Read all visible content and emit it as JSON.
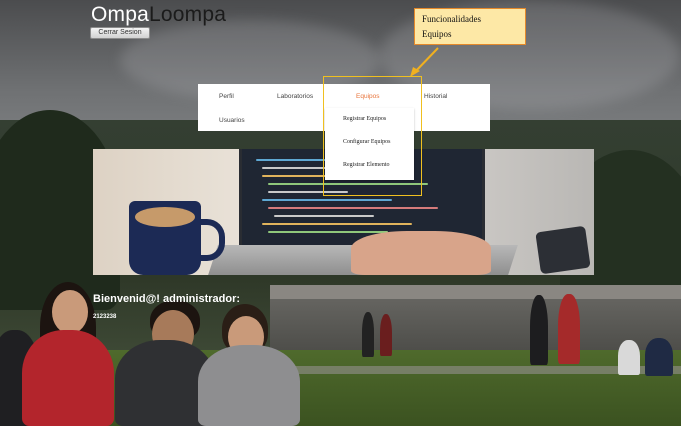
{
  "brand": {
    "part1": "Ompa",
    "part2": "Loompa"
  },
  "header": {
    "logout_label": "Cerrar Sesion"
  },
  "callout": {
    "line1": "Funcionalidades",
    "line2": "Equipos"
  },
  "nav": {
    "items": [
      {
        "label": "Perfil",
        "active": false
      },
      {
        "label": "Laboratorios",
        "active": false
      },
      {
        "label": "Equipos",
        "active": true
      },
      {
        "label": "Historial",
        "active": false
      },
      {
        "label": "Usuarios",
        "active": false
      }
    ],
    "dropdown": [
      "Registrar Equipos",
      "Configurar Equipos",
      "Registrar Elemento"
    ]
  },
  "welcome": {
    "greeting": "Bienvenid@! administrador:",
    "code": "2123238"
  },
  "colors": {
    "accent_orange": "#e8743b",
    "callout_fill": "#fde8a6",
    "callout_border": "#e5892a",
    "highlight_border": "#f0c020",
    "arrow": "#f0b020"
  }
}
